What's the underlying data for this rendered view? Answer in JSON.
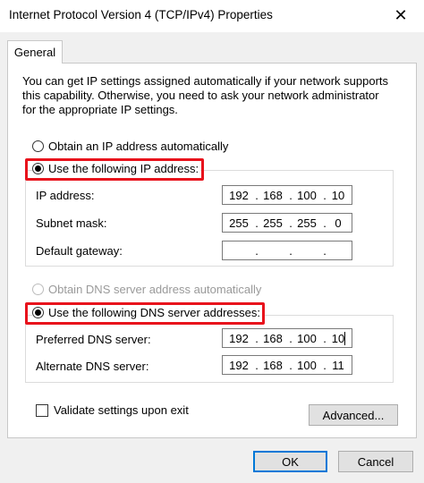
{
  "window": {
    "title": "Internet Protocol Version 4 (TCP/IPv4) Properties",
    "close_glyph": "✕"
  },
  "tabs": [
    {
      "label": "General"
    }
  ],
  "description_lines": [
    "You can get IP settings assigned automatically if your network supports",
    "this capability. Otherwise, you need to ask your network administrator",
    "for the appropriate IP settings."
  ],
  "ip_section": {
    "auto_label": "Obtain an IP address automatically",
    "manual_label": "Use the following IP address:",
    "manual_selected": true,
    "fields": [
      {
        "label": "IP address:",
        "octets": [
          "192",
          "168",
          "100",
          "10"
        ]
      },
      {
        "label": "Subnet mask:",
        "octets": [
          "255",
          "255",
          "255",
          "0"
        ]
      },
      {
        "label": "Default gateway:",
        "octets": [
          "",
          "",
          "",
          ""
        ]
      }
    ]
  },
  "dns_section": {
    "auto_label": "Obtain DNS server address automatically",
    "manual_label": "Use the following DNS server addresses:",
    "manual_selected": true,
    "fields": [
      {
        "label": "Preferred DNS server:",
        "octets": [
          "192",
          "168",
          "100",
          "10"
        ]
      },
      {
        "label": "Alternate DNS server:",
        "octets": [
          "192",
          "168",
          "100",
          "11"
        ]
      }
    ]
  },
  "validate_label": "Validate settings upon exit",
  "validate_checked": false,
  "buttons": {
    "advanced": "Advanced...",
    "ok": "OK",
    "cancel": "Cancel"
  },
  "colors": {
    "highlight": "#e8131c",
    "dialog_bg": "#f0f0f0",
    "default_button_border": "#0078d7"
  }
}
